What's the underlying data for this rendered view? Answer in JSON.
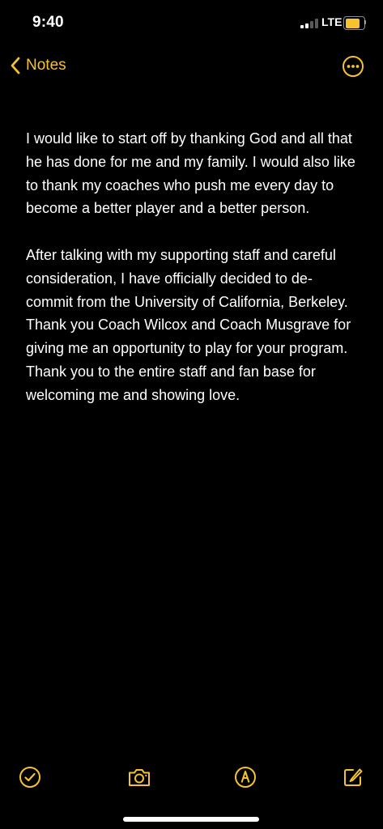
{
  "status_bar": {
    "time": "9:40",
    "network": "LTE",
    "signal_bars_active": 2,
    "signal_bars_total": 4,
    "battery_level": 0.8
  },
  "nav": {
    "back_label": "Notes",
    "back_icon": "chevron-left-icon",
    "more_icon": "ellipsis-circle-icon"
  },
  "note": {
    "paragraphs": [
      "I would like to start off by thanking God and all that he has done for me and my family. I would also like to thank my coaches who push me every day to become a better player and a better person.",
      "After talking with my supporting staff and careful consideration, I have officially decided to de-commit from the University of California, Berkeley. Thank you Coach Wilcox and Coach Musgrave for giving me an opportunity to play for your program. Thank you to the entire staff and fan base for welcoming me and showing love."
    ]
  },
  "toolbar": {
    "icons": [
      "checklist-icon",
      "camera-icon",
      "markup-icon",
      "compose-icon"
    ]
  },
  "colors": {
    "background": "#000000",
    "accent": "#f5c230",
    "text": "#ffffff",
    "battery": "#f5c230"
  }
}
